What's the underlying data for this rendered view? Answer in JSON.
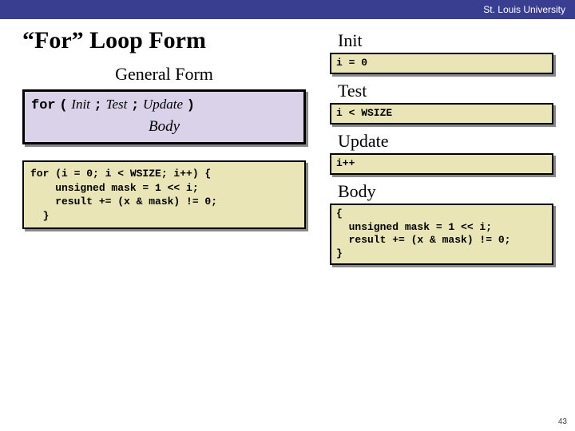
{
  "university": "St. Louis University",
  "title": "“For” Loop Form",
  "left": {
    "general_form_heading": "General Form",
    "syntax": {
      "kw_for": "for",
      "open": "(",
      "init": "Init",
      "sep1": ";",
      "test": "Test",
      "sep2": ";",
      "update": "Update",
      "close": ")",
      "body_label": "Body"
    },
    "code_example": "for (i = 0; i < WSIZE; i++) {\n    unsigned mask = 1 << i;\n    result += (x & mask) != 0;\n  }"
  },
  "right": {
    "init_label": "Init",
    "init_code": "i = 0",
    "test_label": "Test",
    "test_code": "i < WSIZE",
    "update_label": "Update",
    "update_code": "i++",
    "body_label": "Body",
    "body_code": "{\n  unsigned mask = 1 << i;\n  result += (x & mask) != 0;\n}"
  },
  "page_number": "43"
}
